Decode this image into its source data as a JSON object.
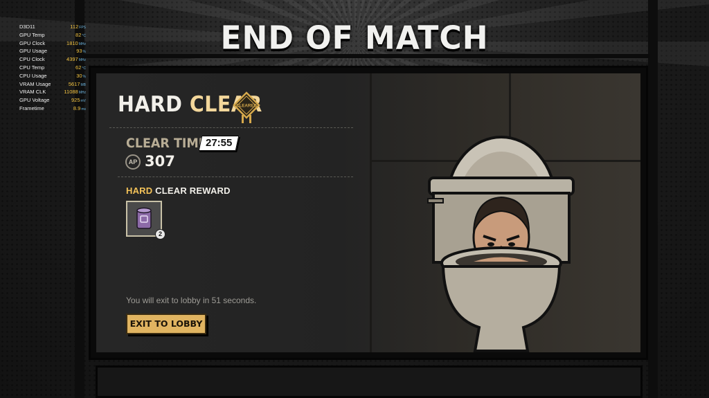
{
  "screen_title": "END OF MATCH",
  "hud": [
    {
      "label": "D3D11",
      "value": "112",
      "unit": "FPS"
    },
    {
      "label": "GPU Temp",
      "value": "82",
      "unit": "°C"
    },
    {
      "label": "GPU Clock",
      "value": "1810",
      "unit": "MHz"
    },
    {
      "label": "GPU Usage",
      "value": "93",
      "unit": "%"
    },
    {
      "label": "CPU Clock",
      "value": "4397",
      "unit": "MHz"
    },
    {
      "label": "CPU Temp",
      "value": "62",
      "unit": "°C"
    },
    {
      "label": "CPU Usage",
      "value": "30",
      "unit": "%"
    },
    {
      "label": "VRAM Usage",
      "value": "5617",
      "unit": "MB"
    },
    {
      "label": "VRAM CLK",
      "value": "11088",
      "unit": "MHz"
    },
    {
      "label": "GPU Voltage",
      "value": "925",
      "unit": "mV"
    },
    {
      "label": "Frametime",
      "value": "8.9",
      "unit": "ms"
    }
  ],
  "result": {
    "difficulty": "HARD",
    "outcome": "CLEAR",
    "badge_text": "CLEARED",
    "clear_time_label": "CLEAR TIME",
    "clear_time": "27:55",
    "ap_icon_text": "AP",
    "ap_value": "307"
  },
  "reward": {
    "title_accent": "HARD",
    "title_rest": "CLEAR REWARD",
    "item_count": "2"
  },
  "exit": {
    "countdown_text": "You will exit to lobby in 51 seconds.",
    "button_label": "EXIT TO LOBBY"
  },
  "colors": {
    "accent_gold": "#f3d79b",
    "button_gold": "#e0b461",
    "hud_value": "#f5c542"
  }
}
